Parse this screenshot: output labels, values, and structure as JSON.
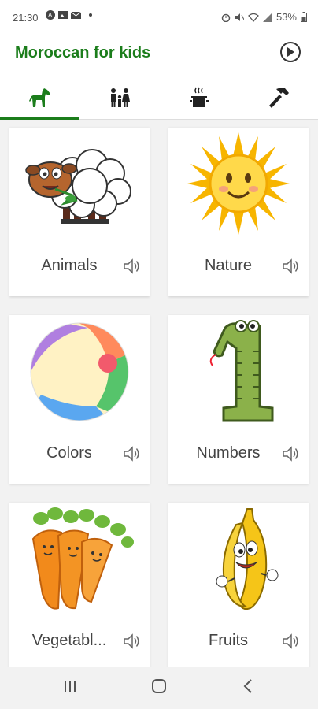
{
  "status": {
    "time": "21:30",
    "battery": "53%"
  },
  "app": {
    "title": "Moroccan for kids"
  },
  "tabs": [
    {
      "icon": "horse-icon"
    },
    {
      "icon": "family-icon"
    },
    {
      "icon": "cooking-pot-icon"
    },
    {
      "icon": "hammer-icon"
    }
  ],
  "cards": [
    {
      "label": "Animals"
    },
    {
      "label": "Nature"
    },
    {
      "label": "Colors"
    },
    {
      "label": "Numbers"
    },
    {
      "label": "Vegetabl..."
    },
    {
      "label": "Fruits"
    }
  ],
  "accent": "#1b7d1b"
}
